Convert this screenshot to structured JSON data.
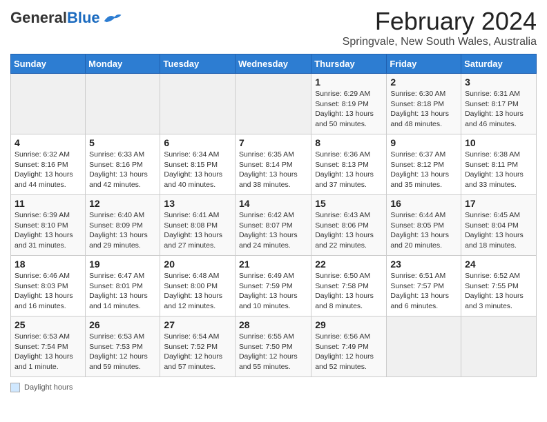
{
  "header": {
    "logo_general": "General",
    "logo_blue": "Blue",
    "month": "February 2024",
    "location": "Springvale, New South Wales, Australia"
  },
  "days_of_week": [
    "Sunday",
    "Monday",
    "Tuesday",
    "Wednesday",
    "Thursday",
    "Friday",
    "Saturday"
  ],
  "weeks": [
    [
      {
        "day": "",
        "info": ""
      },
      {
        "day": "",
        "info": ""
      },
      {
        "day": "",
        "info": ""
      },
      {
        "day": "",
        "info": ""
      },
      {
        "day": "1",
        "info": "Sunrise: 6:29 AM\nSunset: 8:19 PM\nDaylight: 13 hours\nand 50 minutes."
      },
      {
        "day": "2",
        "info": "Sunrise: 6:30 AM\nSunset: 8:18 PM\nDaylight: 13 hours\nand 48 minutes."
      },
      {
        "day": "3",
        "info": "Sunrise: 6:31 AM\nSunset: 8:17 PM\nDaylight: 13 hours\nand 46 minutes."
      }
    ],
    [
      {
        "day": "4",
        "info": "Sunrise: 6:32 AM\nSunset: 8:16 PM\nDaylight: 13 hours\nand 44 minutes."
      },
      {
        "day": "5",
        "info": "Sunrise: 6:33 AM\nSunset: 8:16 PM\nDaylight: 13 hours\nand 42 minutes."
      },
      {
        "day": "6",
        "info": "Sunrise: 6:34 AM\nSunset: 8:15 PM\nDaylight: 13 hours\nand 40 minutes."
      },
      {
        "day": "7",
        "info": "Sunrise: 6:35 AM\nSunset: 8:14 PM\nDaylight: 13 hours\nand 38 minutes."
      },
      {
        "day": "8",
        "info": "Sunrise: 6:36 AM\nSunset: 8:13 PM\nDaylight: 13 hours\nand 37 minutes."
      },
      {
        "day": "9",
        "info": "Sunrise: 6:37 AM\nSunset: 8:12 PM\nDaylight: 13 hours\nand 35 minutes."
      },
      {
        "day": "10",
        "info": "Sunrise: 6:38 AM\nSunset: 8:11 PM\nDaylight: 13 hours\nand 33 minutes."
      }
    ],
    [
      {
        "day": "11",
        "info": "Sunrise: 6:39 AM\nSunset: 8:10 PM\nDaylight: 13 hours\nand 31 minutes."
      },
      {
        "day": "12",
        "info": "Sunrise: 6:40 AM\nSunset: 8:09 PM\nDaylight: 13 hours\nand 29 minutes."
      },
      {
        "day": "13",
        "info": "Sunrise: 6:41 AM\nSunset: 8:08 PM\nDaylight: 13 hours\nand 27 minutes."
      },
      {
        "day": "14",
        "info": "Sunrise: 6:42 AM\nSunset: 8:07 PM\nDaylight: 13 hours\nand 24 minutes."
      },
      {
        "day": "15",
        "info": "Sunrise: 6:43 AM\nSunset: 8:06 PM\nDaylight: 13 hours\nand 22 minutes."
      },
      {
        "day": "16",
        "info": "Sunrise: 6:44 AM\nSunset: 8:05 PM\nDaylight: 13 hours\nand 20 minutes."
      },
      {
        "day": "17",
        "info": "Sunrise: 6:45 AM\nSunset: 8:04 PM\nDaylight: 13 hours\nand 18 minutes."
      }
    ],
    [
      {
        "day": "18",
        "info": "Sunrise: 6:46 AM\nSunset: 8:03 PM\nDaylight: 13 hours\nand 16 minutes."
      },
      {
        "day": "19",
        "info": "Sunrise: 6:47 AM\nSunset: 8:01 PM\nDaylight: 13 hours\nand 14 minutes."
      },
      {
        "day": "20",
        "info": "Sunrise: 6:48 AM\nSunset: 8:00 PM\nDaylight: 13 hours\nand 12 minutes."
      },
      {
        "day": "21",
        "info": "Sunrise: 6:49 AM\nSunset: 7:59 PM\nDaylight: 13 hours\nand 10 minutes."
      },
      {
        "day": "22",
        "info": "Sunrise: 6:50 AM\nSunset: 7:58 PM\nDaylight: 13 hours\nand 8 minutes."
      },
      {
        "day": "23",
        "info": "Sunrise: 6:51 AM\nSunset: 7:57 PM\nDaylight: 13 hours\nand 6 minutes."
      },
      {
        "day": "24",
        "info": "Sunrise: 6:52 AM\nSunset: 7:55 PM\nDaylight: 13 hours\nand 3 minutes."
      }
    ],
    [
      {
        "day": "25",
        "info": "Sunrise: 6:53 AM\nSunset: 7:54 PM\nDaylight: 13 hours\nand 1 minute."
      },
      {
        "day": "26",
        "info": "Sunrise: 6:53 AM\nSunset: 7:53 PM\nDaylight: 12 hours\nand 59 minutes."
      },
      {
        "day": "27",
        "info": "Sunrise: 6:54 AM\nSunset: 7:52 PM\nDaylight: 12 hours\nand 57 minutes."
      },
      {
        "day": "28",
        "info": "Sunrise: 6:55 AM\nSunset: 7:50 PM\nDaylight: 12 hours\nand 55 minutes."
      },
      {
        "day": "29",
        "info": "Sunrise: 6:56 AM\nSunset: 7:49 PM\nDaylight: 12 hours\nand 52 minutes."
      },
      {
        "day": "",
        "info": ""
      },
      {
        "day": "",
        "info": ""
      }
    ]
  ],
  "footer": {
    "legend_label": "Daylight hours"
  }
}
